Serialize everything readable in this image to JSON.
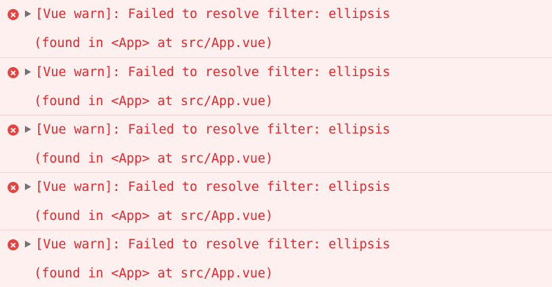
{
  "console": {
    "entries": [
      {
        "level": "error",
        "icon": "error-x-icon",
        "message": "[Vue warn]: Failed to resolve filter: ellipsis",
        "detail": "(found in <App> at src/App.vue)"
      },
      {
        "level": "error",
        "icon": "error-x-icon",
        "message": "[Vue warn]: Failed to resolve filter: ellipsis",
        "detail": "(found in <App> at src/App.vue)"
      },
      {
        "level": "error",
        "icon": "error-x-icon",
        "message": "[Vue warn]: Failed to resolve filter: ellipsis",
        "detail": "(found in <App> at src/App.vue)"
      },
      {
        "level": "error",
        "icon": "error-x-icon",
        "message": "[Vue warn]: Failed to resolve filter: ellipsis",
        "detail": "(found in <App> at src/App.vue)"
      },
      {
        "level": "error",
        "icon": "error-x-icon",
        "message": "[Vue warn]: Failed to resolve filter: ellipsis",
        "detail": "(found in <App> at src/App.vue)"
      }
    ]
  },
  "colors": {
    "error_text": "#e6262b",
    "error_background": "#fff0f0",
    "error_icon": "#e8423f",
    "separator": "#f6d1d3"
  }
}
